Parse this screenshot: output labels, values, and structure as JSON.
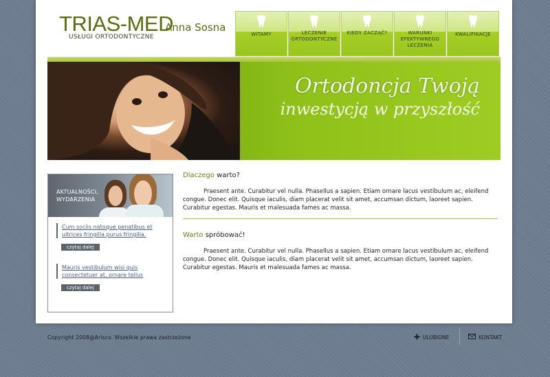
{
  "logo": {
    "main": "TRIAS-MED",
    "owner": "Anna Sosna",
    "subtitle": "USŁUGI ORTODONTYCZNE"
  },
  "nav": {
    "items": [
      {
        "label": "WITAMY",
        "icon": "tooth-icon"
      },
      {
        "label": "LECZENIE ORTODONTYCZNE",
        "icon": "tooth-icon"
      },
      {
        "label": "KIEDY ZACZĄĆ?",
        "icon": "tooth-icon"
      },
      {
        "label": "WARUNKI EFEKTYWNEGO LECZENIA",
        "icon": "tooth-icon"
      },
      {
        "label": "KWALIFIKACJE",
        "icon": "tooth-icon"
      }
    ]
  },
  "banner": {
    "line1": "Ortodoncja Twoją",
    "line2": "inwestycją w przyszłość"
  },
  "news": {
    "title": "AKTUALNOŚCI, WYDARZENIA",
    "items": [
      {
        "text": "Cum sociis natoque penatibus et ultrices fringilla purus fringilla.",
        "more": "czytaj dalej"
      },
      {
        "text": "Mauris vestibulum wisi quis consectetuer at, ornare tellus",
        "more": "czytaj dalej"
      }
    ]
  },
  "content": {
    "sections": [
      {
        "accent": "Dlaczego",
        "rest": " warto?",
        "body": "Praesent ante. Curabitur vel nulla. Phasellus a sapien. Etiam ornare lacus vestibulum ac, eleifend congue. Donec elit. Quisque iaculis, diam placerat velit sit amet, accumsan dictum, laoreet sapien. Curabitur egestas. Mauris et malesuada fames ac massa."
      },
      {
        "accent": "Warto",
        "rest": " spróbować!",
        "body": "Praesent ante. Curabitur vel nulla. Phasellus a sapien. Etiam ornare lacus vestibulum ac, eleifend congue. Donec elit. Quisque iaculis, diam placerat velit sit amet, accumsan dictum, laoreet sapien. Curabitur egestas. Mauris et malesuada fames ac massa."
      }
    ]
  },
  "footer": {
    "copyright": "Copyright 2008@Arisco. Wszelkie prawa zastrzeżone",
    "favorites": "ULUBIONE",
    "contact": "KONTAKT"
  },
  "colors": {
    "accent_green": "#9ac51e",
    "logo_olive": "#5e6b0e",
    "background": "#6e7d91"
  }
}
